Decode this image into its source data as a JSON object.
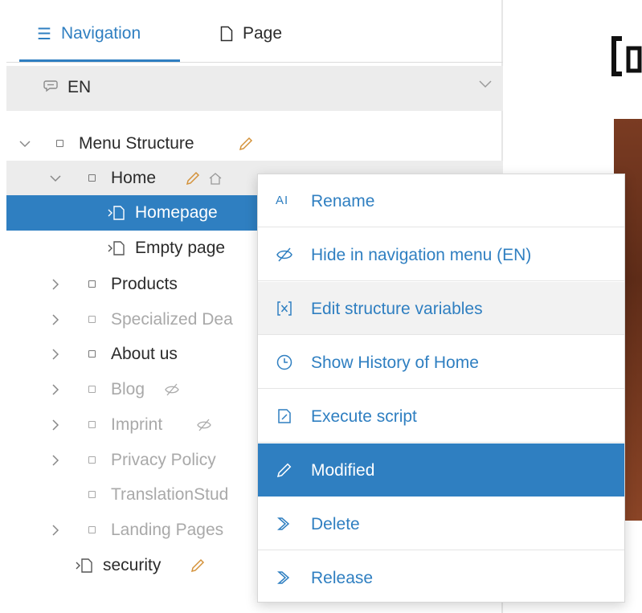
{
  "tabs": [
    {
      "label": "Navigation",
      "icon": "list-icon",
      "active": true
    },
    {
      "label": "Page",
      "icon": "page-icon",
      "active": false
    }
  ],
  "language": {
    "label": "EN",
    "icon": "speech-bubble-icon"
  },
  "tree": [
    {
      "label": "Menu Structure"
    },
    {
      "label": "Home"
    },
    {
      "label": "Homepage"
    },
    {
      "label": "Empty page"
    },
    {
      "label": "Products"
    },
    {
      "label": "Specialized Dea"
    },
    {
      "label": "About us"
    },
    {
      "label": "Blog"
    },
    {
      "label": "Imprint"
    },
    {
      "label": "Privacy Policy"
    },
    {
      "label": "TranslationStud"
    },
    {
      "label": "Landing Pages"
    },
    {
      "label": "security"
    }
  ],
  "context_menu": [
    {
      "label": "Rename",
      "icon": "rename-icon"
    },
    {
      "label": "Hide in navigation menu (EN)",
      "icon": "eye-slash-icon"
    },
    {
      "label": "Edit structure variables",
      "icon": "variable-icon"
    },
    {
      "label": "Show History of Home",
      "icon": "clock-icon"
    },
    {
      "label": "Execute script",
      "icon": "script-icon"
    },
    {
      "label": "Modified",
      "icon": "pencil-icon"
    },
    {
      "label": "Delete",
      "icon": "workflow-icon"
    },
    {
      "label": "Release",
      "icon": "workflow-icon"
    }
  ],
  "colors": {
    "accent": "#2f7fc1",
    "pencil": "#d4923a",
    "muted": "#a9a9a9"
  }
}
